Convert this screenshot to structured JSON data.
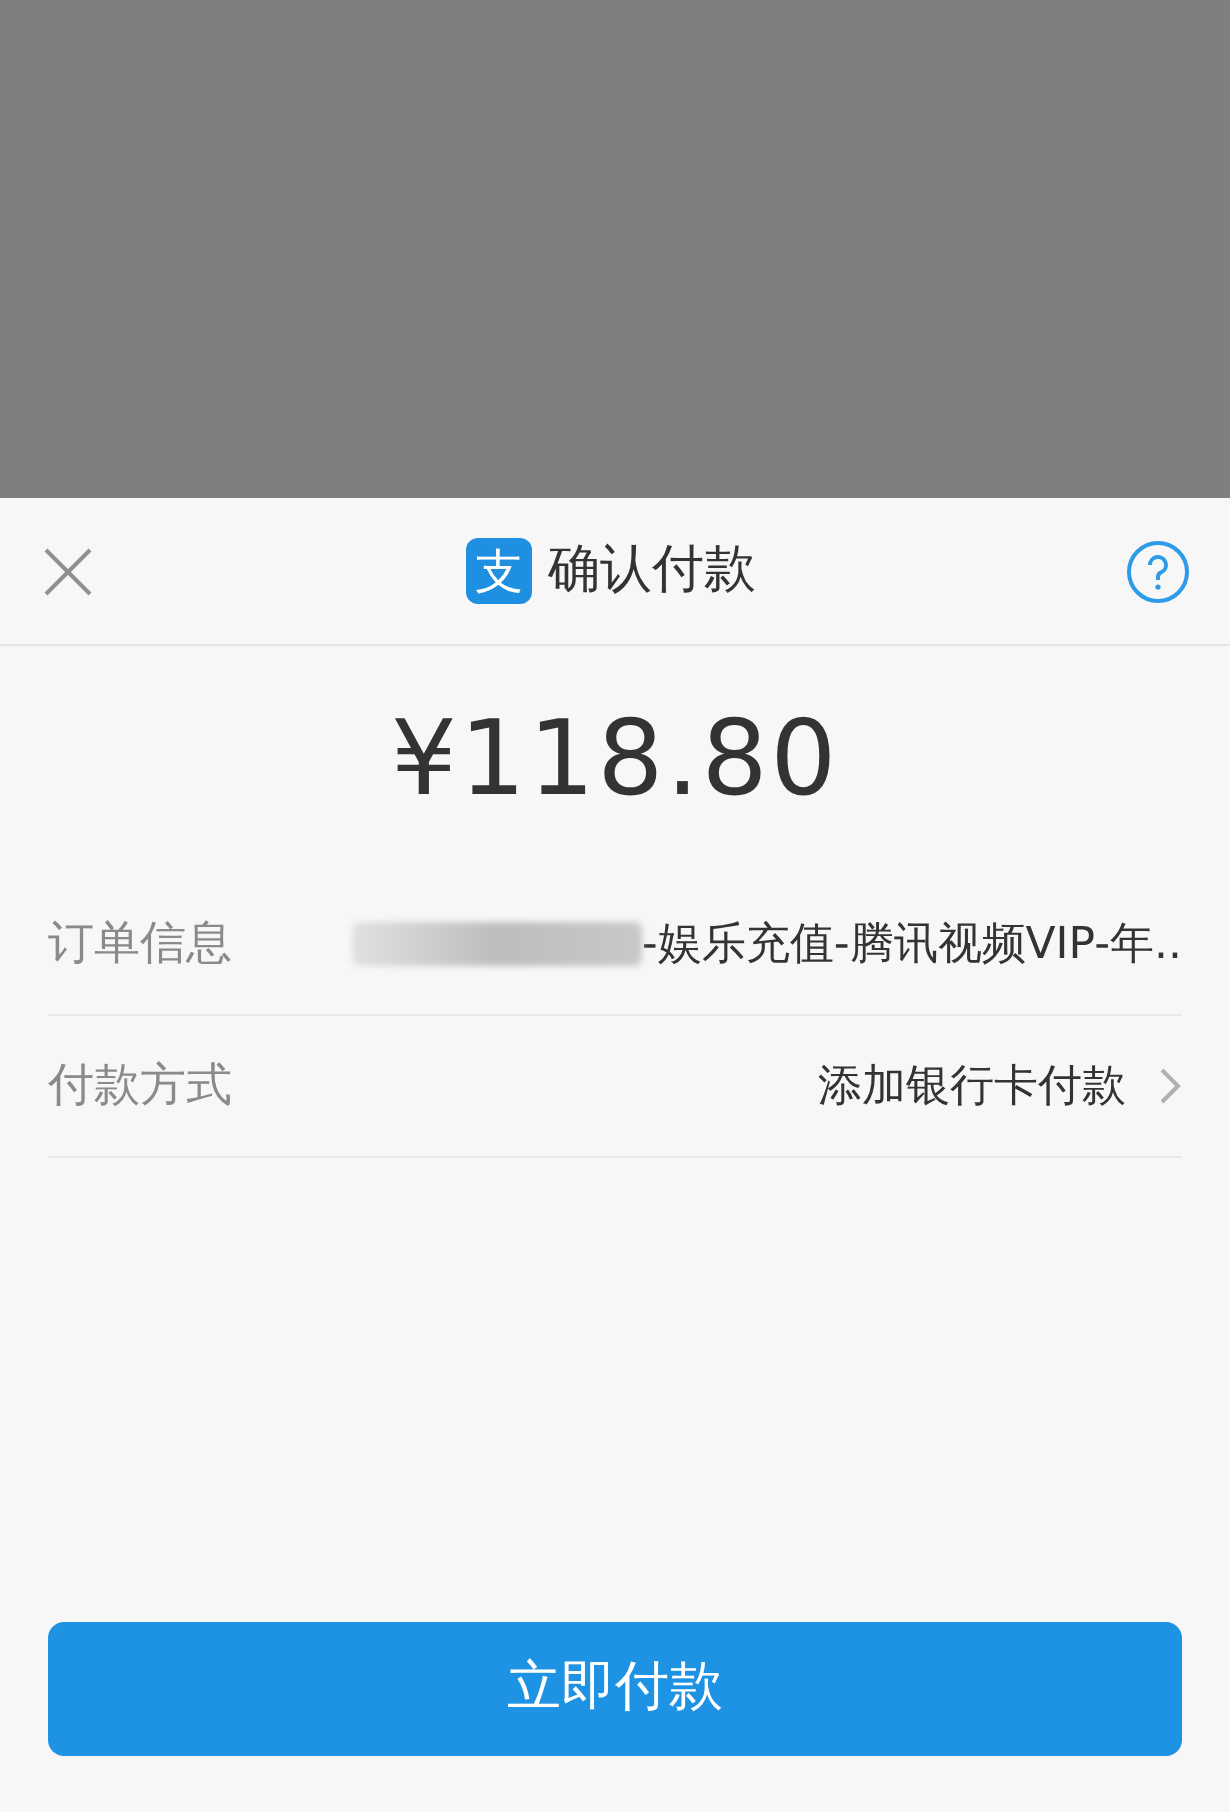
{
  "sheet": {
    "title": "确认付款",
    "logo_glyph": "支"
  },
  "amount": "¥118.80",
  "rows": [
    {
      "kind": "order",
      "label": "订单信息",
      "redacted": true,
      "value": "-娱乐充值-腾讯视频VIP-年.."
    },
    {
      "kind": "method",
      "label": "付款方式",
      "value": "添加银行卡付款"
    }
  ],
  "pay_button": "立即付款"
}
